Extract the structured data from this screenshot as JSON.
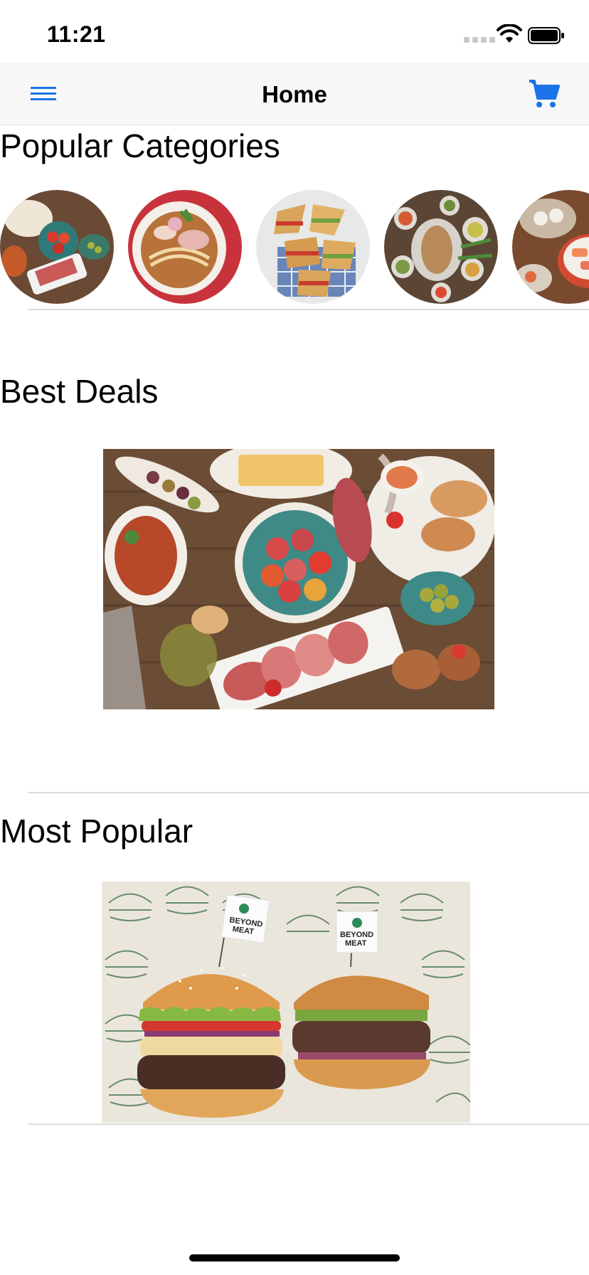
{
  "status_bar": {
    "time": "11:21",
    "icons": [
      "cellular-signal-icon",
      "wifi-icon",
      "battery-icon"
    ]
  },
  "nav": {
    "title": "Home",
    "left_icon": "hamburger-menu-icon",
    "right_icon": "shopping-cart-icon",
    "accent_color": "#1a73e8"
  },
  "sections": {
    "popular_categories": "Popular Categories",
    "best_deals": "Best Deals",
    "most_popular": "Most Popular"
  },
  "categories": [
    {
      "name": "category-tapas-platter"
    },
    {
      "name": "category-noodle-soup"
    },
    {
      "name": "category-sandwiches"
    },
    {
      "name": "category-mezze-spread"
    },
    {
      "name": "category-sushi"
    }
  ],
  "best_deals_image": {
    "name": "tapas-spread-image"
  },
  "most_popular_image": {
    "name": "burgers-image",
    "logo_text": "BEYOND MEAT"
  }
}
